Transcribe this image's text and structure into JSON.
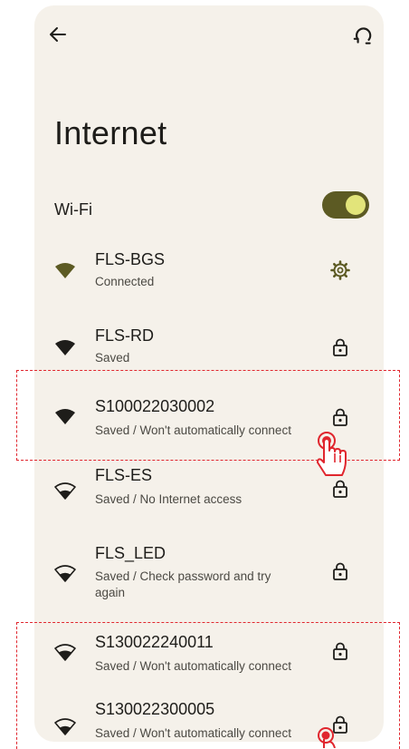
{
  "screen": {
    "title": "Internet",
    "wifi_label": "Wi-Fi",
    "wifi_enabled": true,
    "icons": {
      "back": "arrow-back-icon",
      "refresh": "refresh-icon"
    }
  },
  "networks": [
    {
      "ssid": "FLS-BGS",
      "status": "Connected",
      "trailing_icon": "gear-icon",
      "connected": true
    },
    {
      "ssid": "FLS-RD",
      "status": "Saved",
      "trailing_icon": "lock-icon"
    },
    {
      "ssid": "S100022030002",
      "status": "Saved / Won't automatically connect",
      "trailing_icon": "lock-icon"
    },
    {
      "ssid": "FLS-ES",
      "status": "Saved / No Internet access",
      "trailing_icon": "lock-icon"
    },
    {
      "ssid": "FLS_LED",
      "status": "Saved / Check password and try again",
      "trailing_icon": "lock-icon"
    },
    {
      "ssid": "S130022240011",
      "status": "Saved / Won't automatically connect",
      "trailing_icon": "lock-icon"
    },
    {
      "ssid": "S130022300005",
      "status": "Saved / Won't automatically connect",
      "trailing_icon": "lock-icon"
    }
  ],
  "colors": {
    "background": "#f5f1ea",
    "accent": "#5c5a23",
    "toggle_knob": "#e2e47a",
    "annotation": "#e0262e"
  }
}
